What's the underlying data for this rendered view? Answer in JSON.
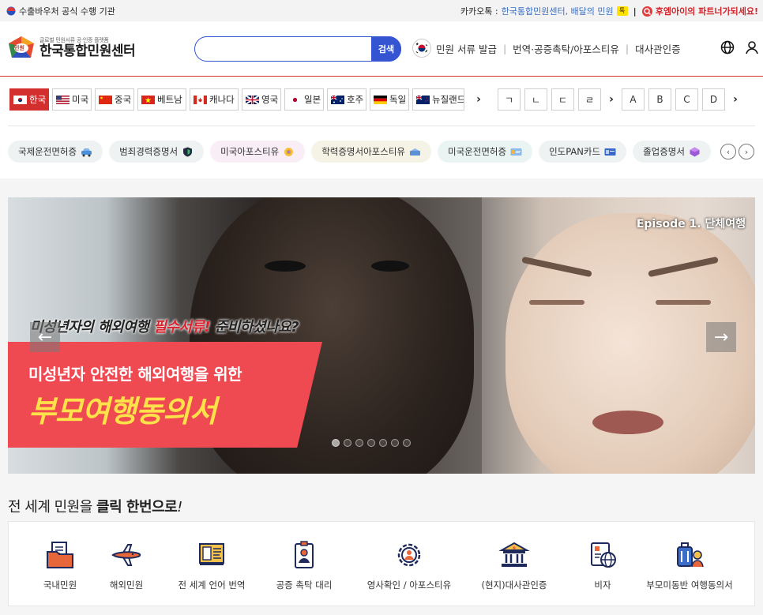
{
  "topbar": {
    "official": "수출바우처 공식 수행 기관",
    "kakao_prefix": "카카오톡 :",
    "kakao_link": "한국통합민원센터, 배달의 민원",
    "kakao_badge": "톡",
    "partner": "후엠아이의 파트너가되세요!"
  },
  "header": {
    "logo_small": "글로벌 민원서류 공·인증 플랫폼",
    "logo_title": "한국통합민원센터",
    "logo_badge": "민원",
    "search_placeholder": "",
    "search_button": "검색",
    "nav": [
      "민원 서류 발급",
      "번역·공증촉탁/아포스티유",
      "대사관인증"
    ],
    "nav_divider": "|"
  },
  "countries": [
    {
      "label": "한국",
      "active": true
    },
    {
      "label": "미국",
      "active": false
    },
    {
      "label": "중국",
      "active": false
    },
    {
      "label": "베트남",
      "active": false
    },
    {
      "label": "캐나다",
      "active": false
    },
    {
      "label": "영국",
      "active": false
    },
    {
      "label": "일본",
      "active": false
    },
    {
      "label": "호주",
      "active": false
    },
    {
      "label": "독일",
      "active": false
    },
    {
      "label": "뉴질랜드",
      "active": false
    }
  ],
  "letters_ko": [
    "ㄱ",
    "ㄴ",
    "ㄷ",
    "ㄹ"
  ],
  "letters_en": [
    "A",
    "B",
    "C",
    "D"
  ],
  "chips": [
    "국제운전면허증",
    "범죄경력증명서",
    "미국아포스티유",
    "학력증명서아포스티유",
    "미국운전면허증",
    "인도PAN카드",
    "졸업증명서"
  ],
  "banner": {
    "episode": "Episode 1. 단체여행",
    "headline_a": "미성년자의 해외여행 ",
    "headline_b": "필수서류!",
    "headline_c": " 준비하셨나요?",
    "line1": "미성년자 안전한 해외여행을 위한",
    "line2": "부모여행동의서",
    "slides": 7,
    "current_slide": 1
  },
  "section": {
    "prefix": "전 세계 민원을 ",
    "bold": "클릭 한번으로",
    "slash": "!"
  },
  "services": [
    "국내민원",
    "해외민원",
    "전 세계 언어 번역",
    "공증 촉탁 대리",
    "영사확인 / 아포스티유",
    "(현지)대사관인증",
    "비자",
    "부모미동반 여행동의서"
  ],
  "colors": {
    "accent": "#d32f2f",
    "primary": "#3454d1",
    "service_orange": "#e8673a",
    "service_navy": "#1f2a5c"
  }
}
